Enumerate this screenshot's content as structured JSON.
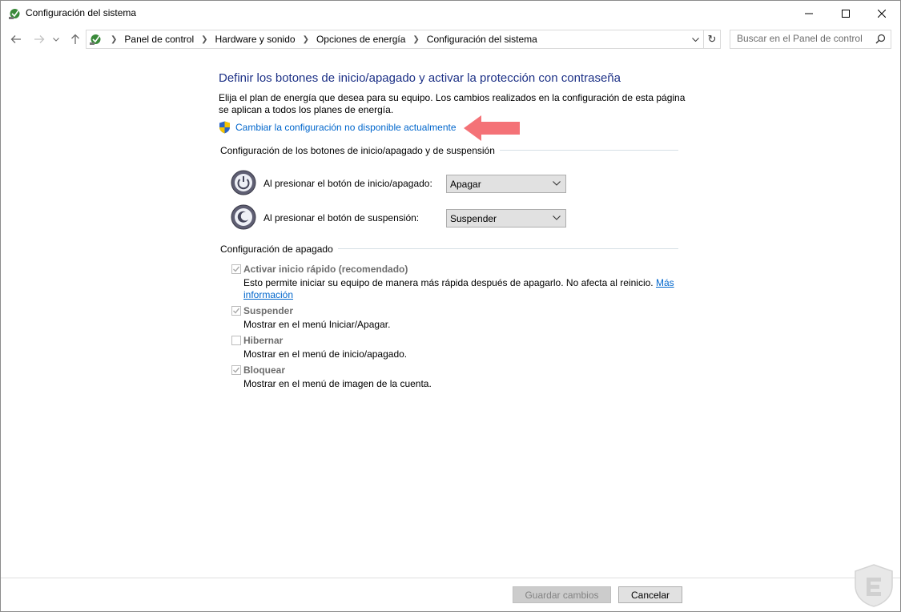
{
  "window": {
    "title": "Configuración del sistema"
  },
  "address": {
    "breadcrumbs": [
      "Panel de control",
      "Hardware y sonido",
      "Opciones de energía",
      "Configuración del sistema"
    ]
  },
  "search": {
    "placeholder": "Buscar en el Panel de control"
  },
  "content": {
    "heading": "Definir los botones de inicio/apagado y activar la protección con contraseña",
    "description": "Elija el plan de energía que desea para su equipo. Los cambios realizados en la configuración de esta página se aplican a todos los planes de energía.",
    "change_link": "Cambiar la configuración no disponible actualmente"
  },
  "buttons_section": {
    "title": "Configuración de los botones de inicio/apagado y de suspensión",
    "power_label": "Al presionar el botón de inicio/apagado:",
    "power_value": "Apagar",
    "sleep_label": "Al presionar el botón de suspensión:",
    "sleep_value": "Suspender"
  },
  "shutdown_section": {
    "title": "Configuración de apagado",
    "items": [
      {
        "label": "Activar inicio rápido (recomendado)",
        "description": "Esto permite iniciar su equipo de manera más rápida después de apagarlo. No afecta al reinicio.",
        "link": "Más información",
        "checked": true
      },
      {
        "label": "Suspender",
        "description": "Mostrar en el menú Iniciar/Apagar.",
        "checked": true
      },
      {
        "label": "Hibernar",
        "description": "Mostrar en el menú de inicio/apagado.",
        "checked": false
      },
      {
        "label": "Bloquear",
        "description": "Mostrar en el menú de imagen de la cuenta.",
        "checked": true
      }
    ]
  },
  "footer": {
    "save_label": "Guardar cambios",
    "cancel_label": "Cancelar"
  },
  "colors": {
    "heading": "#1e3287",
    "link": "#0066cc",
    "callout_arrow": "#f47277"
  }
}
